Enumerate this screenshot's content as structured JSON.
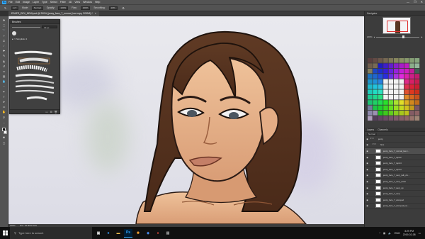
{
  "app": {
    "logo": "Ps"
  },
  "menu": [
    "File",
    "Edit",
    "Image",
    "Layer",
    "Type",
    "Select",
    "Filter",
    "3D",
    "View",
    "Window",
    "Help"
  ],
  "window_controls": {
    "minimize": "—",
    "maximize": "❐",
    "close": "✕"
  },
  "options": {
    "mode_label": "Mode:",
    "mode_value": "Normal",
    "opacity_label": "Opacity:",
    "opacity_value": "100%",
    "flow_label": "Flow:",
    "flow_value": "100%",
    "smoothing_label": "Smoothing:",
    "smoothing_value": "10%"
  },
  "document_tab": {
    "title": "ESAFE_DEV_NEW.psd @ 200% (jenny_face_7_normal_low copy, RGB/8) *",
    "close": "×"
  },
  "brushes_panel": {
    "title": "Brushes",
    "size_value": "40 px",
    "folder_name": "Simplistic 4"
  },
  "navigator": {
    "tabs": [
      "Navigator"
    ],
    "zoom": "200%"
  },
  "layers_panel": {
    "tabs": [
      "Layers",
      "Channels"
    ],
    "mode": "Normal",
    "rows": [
      {
        "name": "jenny",
        "group": true
      },
      {
        "name": "face",
        "group": true
      },
      {
        "name": "jenny_face_7_normal_low c...",
        "selected": true
      },
      {
        "name": "jenny_face_7_topic2"
      },
      {
        "name": "jenny_face_7_topic4"
      },
      {
        "name": "jenny_face_7_topic3"
      },
      {
        "name": "jenny_face_7_sexy_talk_clo..."
      },
      {
        "name": "jenny_face_7_sexy_down"
      },
      {
        "name": "jenny_face_7_sexy_up"
      },
      {
        "name": "jenny_face_7_sexy"
      },
      {
        "name": "jenny_face_7_annoyed"
      },
      {
        "name": "jenny_face_7_annoyed_loo..."
      }
    ]
  },
  "status": {
    "zoom": "200%",
    "doc": "Doc: 94.9M/2.22G"
  },
  "taskbar": {
    "search_placeholder": "Type here to search",
    "time": "3:29 PM",
    "date": "2019-02-08",
    "lang": "ENG"
  },
  "colors": {
    "accent": "#31a8ff",
    "ui_bg": "#535353",
    "panel": "#3c3c3c",
    "hair": "#5a3622",
    "skin": "#e6b48e"
  }
}
